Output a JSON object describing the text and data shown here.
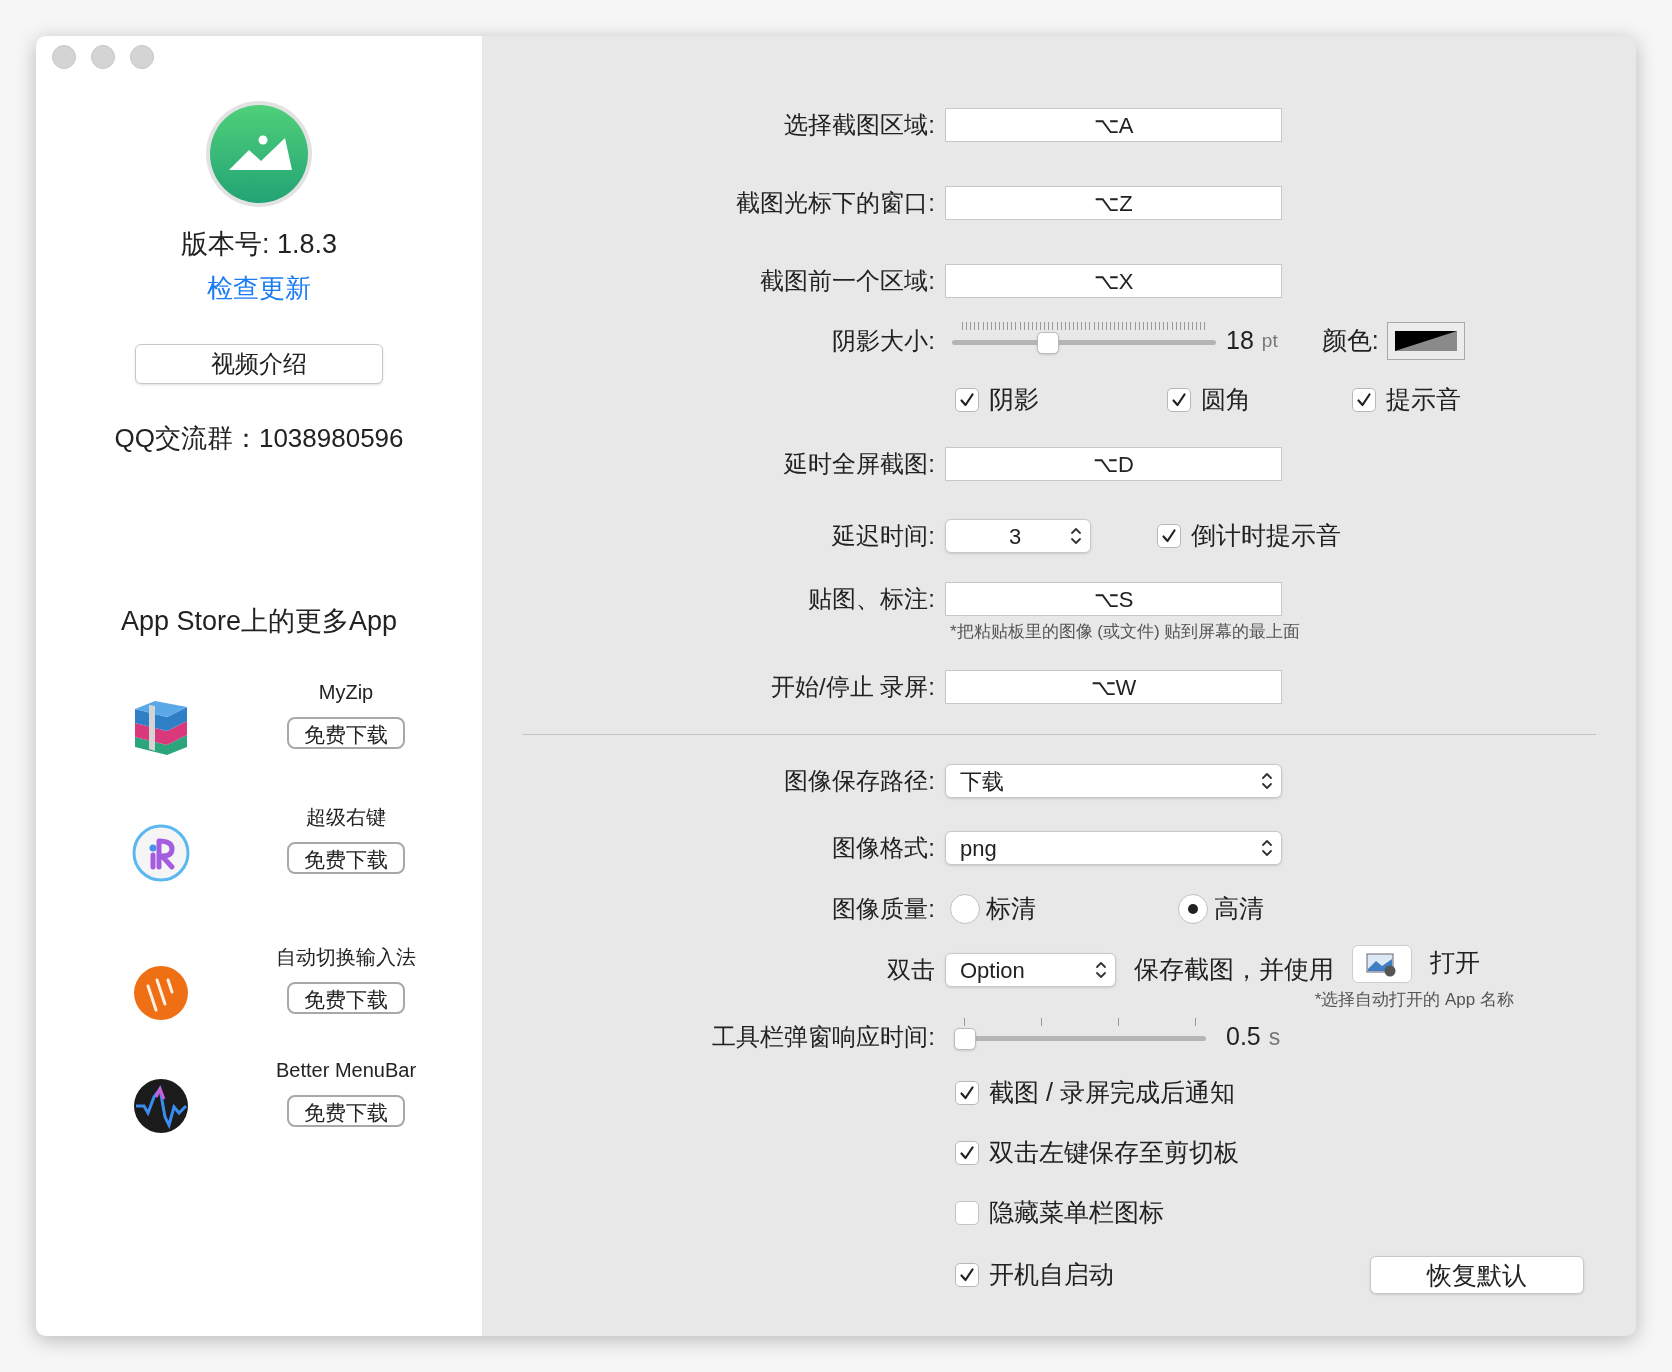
{
  "sidebar": {
    "version": "版本号: 1.8.3",
    "check_update": "检查更新",
    "video_button": "视频介绍",
    "qq_group": "QQ交流群：1038980596",
    "more_apps_title": "App Store上的更多App",
    "apps": [
      {
        "name": "MyZip",
        "button": "免费下载"
      },
      {
        "name": "超级右键",
        "button": "免费下载"
      },
      {
        "name": "自动切换输入法",
        "button": "免费下载"
      },
      {
        "name": "Better MenuBar",
        "button": "免费下载"
      }
    ]
  },
  "settings": {
    "shortcuts": [
      {
        "label": "选择截图区域:",
        "value": "⌥A"
      },
      {
        "label": "截图光标下的窗口:",
        "value": "⌥Z"
      },
      {
        "label": "截图前一个区域:",
        "value": "⌥X"
      }
    ],
    "shadow_size": {
      "label": "阴影大小:",
      "level": 0.35,
      "value": "18",
      "unit": "pt"
    },
    "color": {
      "label": "颜色:"
    },
    "options": [
      {
        "label": "阴影",
        "checked": true
      },
      {
        "label": "圆角",
        "checked": true
      },
      {
        "label": "提示音",
        "checked": true
      }
    ],
    "delayed_fullscreen": {
      "label": "延时全屏截图:",
      "value": "⌥D"
    },
    "delay": {
      "label": "延迟时间:",
      "value": "3"
    },
    "countdown_sound": {
      "label": "倒计时提示音",
      "checked": true
    },
    "pin": {
      "label": "贴图、标注:",
      "value": "⌥S",
      "note": "*把粘贴板里的图像 (或文件) 贴到屏幕的最上面"
    },
    "record": {
      "label": "开始/停止 录屏:",
      "value": "⌥W"
    },
    "save_path": {
      "label": "图像保存路径:",
      "value": "下载"
    },
    "format": {
      "label": "图像格式:",
      "value": "png"
    },
    "quality": {
      "label": "图像质量:",
      "options": [
        {
          "label": "标清",
          "selected": false
        },
        {
          "label": "高清",
          "selected": true
        }
      ]
    },
    "double_click": {
      "label": "双击",
      "value": "Option",
      "text": "保存截图，并使用",
      "open": "打开",
      "note": "*选择自动打开的 App 名称"
    },
    "toolbar_delay": {
      "label": "工具栏弹窗响应时间:",
      "level": 0,
      "value": "0.5",
      "unit": "s"
    },
    "toggles": [
      {
        "label": "截图 / 录屏完成后通知",
        "checked": true
      },
      {
        "label": "双击左键保存至剪切板",
        "checked": true
      },
      {
        "label": "隐藏菜单栏图标",
        "checked": false
      },
      {
        "label": "开机自启动",
        "checked": true
      }
    ],
    "reset_button": "恢复默认"
  }
}
